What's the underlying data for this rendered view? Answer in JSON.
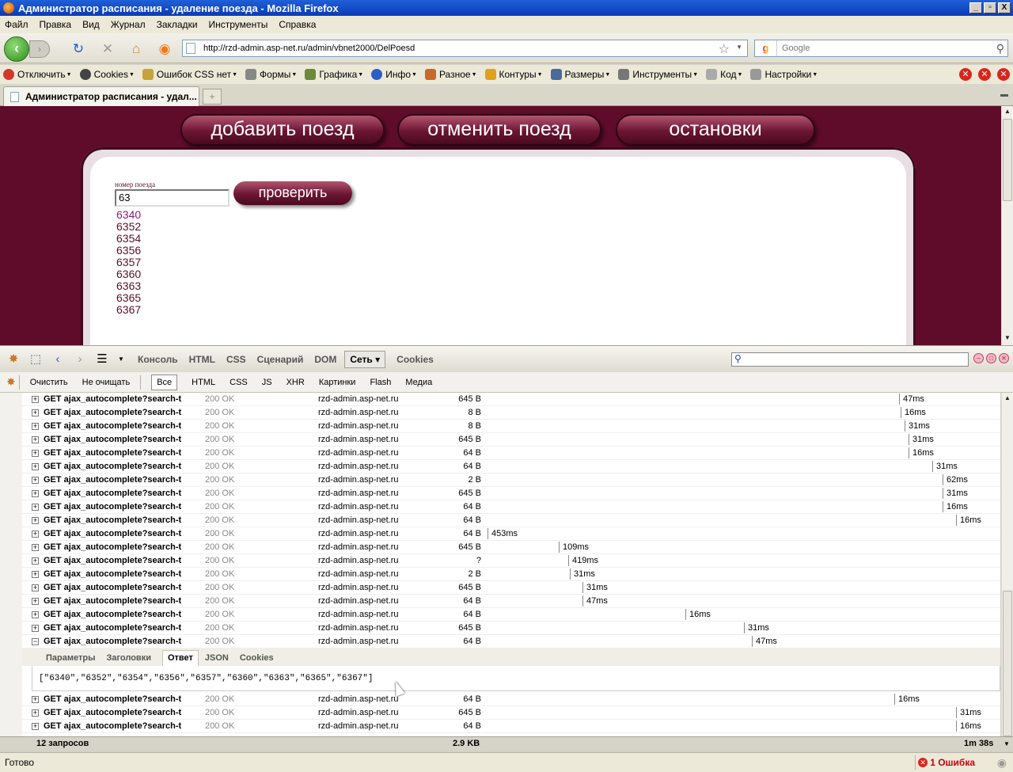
{
  "window": {
    "title": "Администратор расписания - удаление поезда - Mozilla Firefox",
    "min": "_",
    "max": "▫",
    "close": "X"
  },
  "menu": [
    "Файл",
    "Правка",
    "Вид",
    "Журнал",
    "Закладки",
    "Инструменты",
    "Справка"
  ],
  "nav": {
    "url": "http://rzd-admin.asp-net.ru/admin/vbnet2000/DelPoesd",
    "search_placeholder": "Google"
  },
  "devtoolbar": [
    "Отключить",
    "Cookies",
    "Ошибок CSS нет",
    "Формы",
    "Графика",
    "Инфо",
    "Разное",
    "Контуры",
    "Размеры",
    "Инструменты",
    "Код",
    "Настройки"
  ],
  "tab": {
    "title": "Администратор расписания - удал..."
  },
  "page": {
    "buttons": [
      "добавить поезд",
      "отменить поезд",
      "остановки"
    ],
    "field_label": "номер поезда",
    "input_value": "63",
    "check_label": "проверить",
    "suggestions": [
      "6340",
      "6352",
      "6354",
      "6356",
      "6357",
      "6360",
      "6363",
      "6365",
      "6367"
    ]
  },
  "firebug": {
    "tabs": [
      "Консоль",
      "HTML",
      "CSS",
      "Сценарий",
      "DOM",
      "Сеть ▾",
      "Cookies"
    ],
    "active_tab": "Сеть ▾",
    "filters": [
      "Очистить",
      "Не очищать",
      "Все",
      "HTML",
      "CSS",
      "JS",
      "XHR",
      "Картинки",
      "Flash",
      "Медиа"
    ],
    "active_filter": "Все",
    "requests": [
      {
        "req": "GET ajax_autocomplete?search-t",
        "status": "200 OK",
        "domain": "rzd-admin.asp-net.ru",
        "size": "645 B",
        "time": "47ms",
        "expanded": false
      },
      {
        "req": "GET ajax_autocomplete?search-t",
        "status": "200 OK",
        "domain": "rzd-admin.asp-net.ru",
        "size": "8 B",
        "time": "16ms",
        "expanded": false
      },
      {
        "req": "GET ajax_autocomplete?search-t",
        "status": "200 OK",
        "domain": "rzd-admin.asp-net.ru",
        "size": "8 B",
        "time": "31ms",
        "expanded": false
      },
      {
        "req": "GET ajax_autocomplete?search-t",
        "status": "200 OK",
        "domain": "rzd-admin.asp-net.ru",
        "size": "645 B",
        "time": "31ms",
        "expanded": false
      },
      {
        "req": "GET ajax_autocomplete?search-t",
        "status": "200 OK",
        "domain": "rzd-admin.asp-net.ru",
        "size": "64 B",
        "time": "16ms",
        "expanded": false
      },
      {
        "req": "GET ajax_autocomplete?search-t",
        "status": "200 OK",
        "domain": "rzd-admin.asp-net.ru",
        "size": "64 B",
        "time": "31ms",
        "expanded": false
      },
      {
        "req": "GET ajax_autocomplete?search-t",
        "status": "200 OK",
        "domain": "rzd-admin.asp-net.ru",
        "size": "2 B",
        "time": "62ms",
        "expanded": false
      },
      {
        "req": "GET ajax_autocomplete?search-t",
        "status": "200 OK",
        "domain": "rzd-admin.asp-net.ru",
        "size": "645 B",
        "time": "31ms",
        "expanded": false
      },
      {
        "req": "GET ajax_autocomplete?search-t",
        "status": "200 OK",
        "domain": "rzd-admin.asp-net.ru",
        "size": "64 B",
        "time": "16ms",
        "expanded": false
      },
      {
        "req": "GET ajax_autocomplete?search-t",
        "status": "200 OK",
        "domain": "rzd-admin.asp-net.ru",
        "size": "64 B",
        "time": "16ms",
        "expanded": false
      },
      {
        "req": "GET ajax_autocomplete?search-t",
        "status": "200 OK",
        "domain": "rzd-admin.asp-net.ru",
        "size": "64 B",
        "time": "453ms",
        "expanded": false
      },
      {
        "req": "GET ajax_autocomplete?search-t",
        "status": "200 OK",
        "domain": "rzd-admin.asp-net.ru",
        "size": "645 B",
        "time": "109ms",
        "expanded": false
      },
      {
        "req": "GET ajax_autocomplete?search-t",
        "status": "200 OK",
        "domain": "rzd-admin.asp-net.ru",
        "size": "?",
        "time": "419ms",
        "expanded": false
      },
      {
        "req": "GET ajax_autocomplete?search-t",
        "status": "200 OK",
        "domain": "rzd-admin.asp-net.ru",
        "size": "2 B",
        "time": "31ms",
        "expanded": false
      },
      {
        "req": "GET ajax_autocomplete?search-t",
        "status": "200 OK",
        "domain": "rzd-admin.asp-net.ru",
        "size": "645 B",
        "time": "31ms",
        "expanded": false
      },
      {
        "req": "GET ajax_autocomplete?search-t",
        "status": "200 OK",
        "domain": "rzd-admin.asp-net.ru",
        "size": "64 B",
        "time": "47ms",
        "expanded": false
      },
      {
        "req": "GET ajax_autocomplete?search-t",
        "status": "200 OK",
        "domain": "rzd-admin.asp-net.ru",
        "size": "64 B",
        "time": "16ms",
        "expanded": false
      },
      {
        "req": "GET ajax_autocomplete?search-t",
        "status": "200 OK",
        "domain": "rzd-admin.asp-net.ru",
        "size": "645 B",
        "time": "31ms",
        "expanded": false
      },
      {
        "req": "GET ajax_autocomplete?search-t",
        "status": "200 OK",
        "domain": "rzd-admin.asp-net.ru",
        "size": "64 B",
        "time": "47ms",
        "expanded": true
      }
    ],
    "detail_tabs": [
      "Параметры",
      "Заголовки",
      "Ответ",
      "JSON",
      "Cookies"
    ],
    "active_detail": "Ответ",
    "response": "[\"6340\",\"6352\",\"6354\",\"6356\",\"6357\",\"6360\",\"6363\",\"6365\",\"6367\"]",
    "requests_after": [
      {
        "req": "GET ajax_autocomplete?search-t",
        "status": "200 OK",
        "domain": "rzd-admin.asp-net.ru",
        "size": "64 B",
        "time": "16ms"
      },
      {
        "req": "GET ajax_autocomplete?search-t",
        "status": "200 OK",
        "domain": "rzd-admin.asp-net.ru",
        "size": "645 B",
        "time": "31ms"
      },
      {
        "req": "GET ajax_autocomplete?search-t",
        "status": "200 OK",
        "domain": "rzd-admin.asp-net.ru",
        "size": "64 B",
        "time": "16ms"
      }
    ],
    "footer": {
      "count": "12 запросов",
      "total_size": "2.9 KB",
      "total_time": "1m 38s"
    }
  },
  "status": {
    "text": "Готово",
    "errors": "1 Ошибка"
  }
}
